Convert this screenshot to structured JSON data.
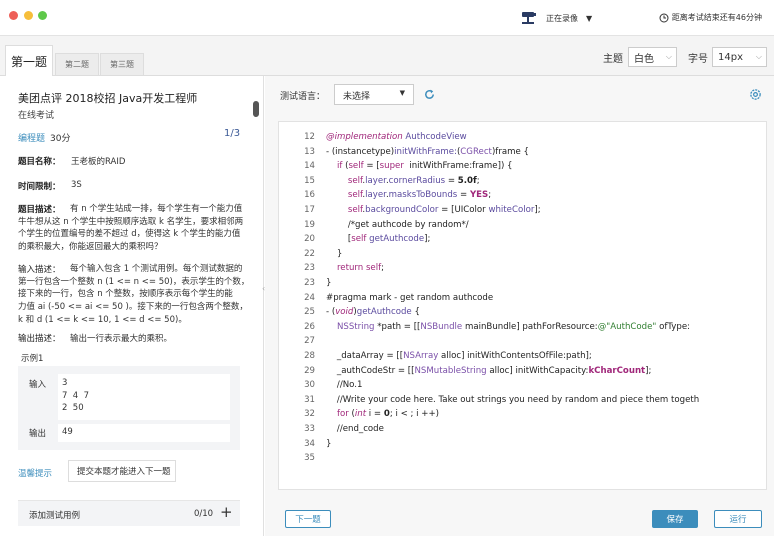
{
  "window": {
    "recording_label": "正在录像",
    "timer_text": "距离考试结束还有46分钟"
  },
  "tabs": [
    "第一题",
    "第二题",
    "第三题"
  ],
  "controls": {
    "theme_label": "主题",
    "theme_value": "白色",
    "font_label": "字号",
    "font_value": "14px"
  },
  "question": {
    "title": "美团点评 2018校招 Java开发工程师",
    "subtitle": "在线考试",
    "type": "编程题",
    "score": "30分",
    "page": "1/3",
    "name_label": "题目名称：",
    "name_value": "王老板的RAID",
    "time_label": "时间限制：",
    "time_value": "3S",
    "desc_label": "题目描述：",
    "desc_text": "有 n 个学生站成一排，每个学生有一个能力值\n牛牛想从这 n 个学生中按照顺序选取 k 名学生，要求相邻两\n个学生的位置编号的差不超过 d，使得这 k 个学生的能力值\n的乘积最大，你能返回最大的乘积吗？",
    "input_label": "输入描述：",
    "input_text": "每个输入包含 1 个测试用例。每个测试数据的\n第一行包含一个整数 n (1 <= n <= 50)，表示学生的个数，\n接下来的一行，包含 n 个整数，按顺序表示每个学生的能\n力值 ai (-50 <= ai <= 50 )。接下来的一行包含两个整数，\nk 和 d (1 <= k <= 10, 1 <= d <= 50)。",
    "output_label": "输出描述：",
    "output_text": "输出一行表示最大的乘积。",
    "example_label": "示例1",
    "example_input_label": "输入",
    "example_input": "3\n7  4  7\n2  50",
    "example_output_label": "输出",
    "example_output": "49",
    "hint_link": "温馨提示",
    "hint_text": "提交本题才能进入下一题",
    "add_test_label": "添加测试用例",
    "add_test_count": "0/10",
    "add_test_plus": "+"
  },
  "editor": {
    "lang_label": "测试语言：",
    "lang_value": "未选择",
    "lines": [
      {
        "n": "12",
        "html": "<span class='kw-italic'>@implementation</span> <span class='fn'>AuthcodeView</span>"
      },
      {
        "n": "13",
        "html": "- (instancetype)<span class='fn'>initWithFrame:</span>(<span class='ty'>CGRect</span>)frame {"
      },
      {
        "n": "14",
        "html": "    <span class='kw-purple'>if</span> (<span class='kw-purple'>self</span> = [<span class='kw-purple'>super</span>  initWithFrame:frame]) {"
      },
      {
        "n": "15",
        "html": "        <span class='kw-purple'>self</span>.<span class='fn'>layer</span>.<span class='fn'>cornerRadius</span> = <b>5.0f</b>;"
      },
      {
        "n": "16",
        "html": "        <span class='kw-purple'>self</span>.<span class='fn'>layer</span>.<span class='fn'>masksToBounds</span> = <b><span class='kw-purple'>YES</span></b>;"
      },
      {
        "n": "17",
        "html": "        <span class='kw-purple'>self</span>.<span class='fn'>backgroundColor</span> = [UIColor <span class='fn'>whiteColor</span>];"
      },
      {
        "n": "19",
        "html": "        /*get authcode by random*/"
      },
      {
        "n": "20",
        "html": "        [<span class='kw-purple'>self</span> <span class='fn'>getAuthcode</span>];"
      },
      {
        "n": "22",
        "html": "    }"
      },
      {
        "n": "23",
        "html": "    <span class='kw-purple'>return</span> <span class='kw-purple'>self</span>;"
      },
      {
        "n": "23",
        "html": "}"
      },
      {
        "n": "24",
        "html": "#pragma mark - get random authcode"
      },
      {
        "n": "25",
        "html": "- (<span class='kw-italic'>void</span>)<span class='fn'>getAuthcode</span> {"
      },
      {
        "n": "26",
        "html": "    <span class='ty'>NSString</span> *path = [[<span class='ty'>NSBundle</span> mainBundle] pathForResource:<span class='str'>@\"AuthCode\"</span> ofType:"
      },
      {
        "n": "27",
        "html": ""
      },
      {
        "n": "28",
        "html": "    _dataArray = [[<span class='ty'>NSArray</span> alloc] initWithContentsOfFile:path];"
      },
      {
        "n": "29",
        "html": "    _authCodeStr = [[<span class='ty'>NSMutableString</span> alloc] initWithCapacity:<b><span class='kw-purple'>kCharCount</span></b>];"
      },
      {
        "n": "30",
        "html": "    //No.1"
      },
      {
        "n": "31",
        "html": "    //Write your code here. Take out strings you need by random and piece them togeth"
      },
      {
        "n": "32",
        "html": "    <span class='kw-purple'>for</span> (<span class='kw-italic'>int</span> i = <b>0</b>; i < ; i ++)"
      },
      {
        "n": "33",
        "html": "    //end_code"
      },
      {
        "n": "34",
        "html": "}"
      },
      {
        "n": "35",
        "html": ""
      }
    ]
  },
  "buttons": {
    "next": "下一题",
    "save": "保存",
    "run": "运行"
  },
  "colors": {
    "accent": "#3c8dbc",
    "keyword": "#a0277a",
    "string": "#2f7d2f"
  }
}
